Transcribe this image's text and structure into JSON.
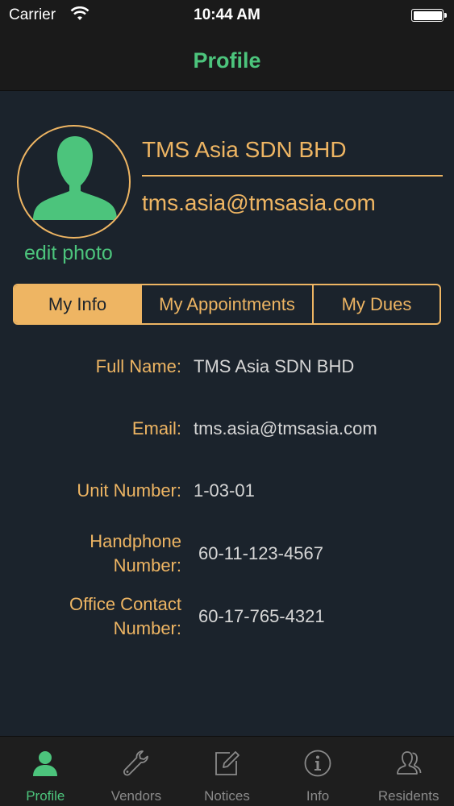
{
  "status_bar": {
    "carrier": "Carrier",
    "time": "10:44 AM"
  },
  "nav": {
    "title": "Profile"
  },
  "profile": {
    "name": "TMS Asia SDN BHD",
    "email": "tms.asia@tmsasia.com",
    "edit_photo": "edit photo",
    "avatar_icon": "person-silhouette-icon"
  },
  "segments": [
    {
      "label": "My Info",
      "active": true
    },
    {
      "label": "My Appointments",
      "active": false
    },
    {
      "label": "My Dues",
      "active": false
    }
  ],
  "info": {
    "full_name_label": "Full Name:",
    "full_name_value": "TMS Asia SDN BHD",
    "email_label": "Email:",
    "email_value": "tms.asia@tmsasia.com",
    "unit_label": "Unit Number:",
    "unit_value": "1-03-01",
    "handphone_label_1": "Handphone",
    "handphone_label_2": "Number:",
    "handphone_value": "60-11-123-4567",
    "office_label_1": "Office Contact",
    "office_label_2": "Number:",
    "office_value": "60-17-765-4321"
  },
  "tabs": [
    {
      "label": "Profile",
      "icon": "person-icon",
      "active": true
    },
    {
      "label": "Vendors",
      "icon": "wrench-icon",
      "active": false
    },
    {
      "label": "Notices",
      "icon": "edit-icon",
      "active": false
    },
    {
      "label": "Info",
      "icon": "info-icon",
      "active": false
    },
    {
      "label": "Residents",
      "icon": "residents-icon",
      "active": false
    }
  ],
  "colors": {
    "accent_orange": "#eeb563",
    "accent_green": "#4cc47c",
    "background": "#1b232c"
  }
}
